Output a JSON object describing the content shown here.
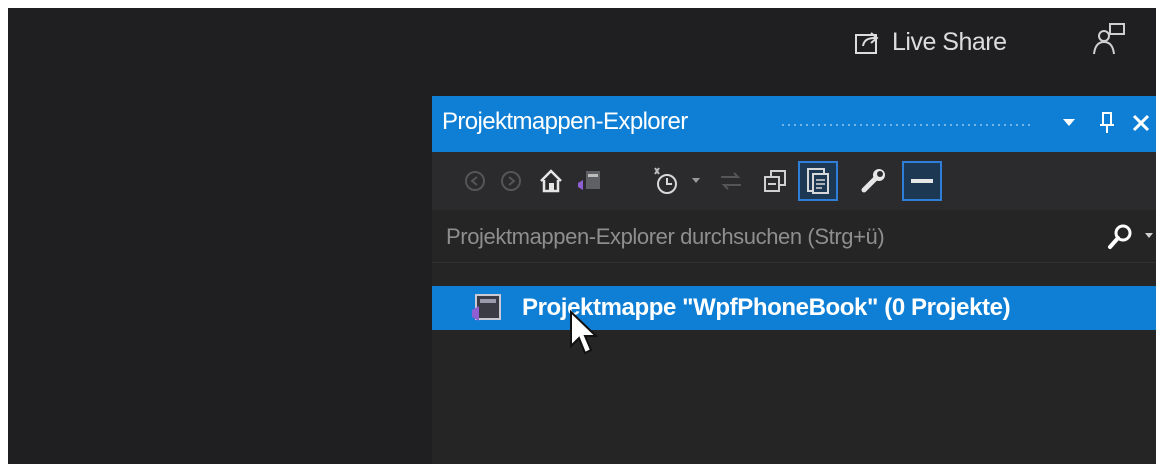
{
  "topbar": {
    "live_share_label": "Live Share",
    "live_share_icon": "live-share-icon",
    "feedback_icon": "feedback-person-icon"
  },
  "solution_explorer": {
    "title": "Projektmappen-Explorer",
    "title_buttons": [
      "dropdown-icon",
      "pin-icon",
      "close-icon"
    ],
    "toolbar_icons": [
      "back-icon",
      "forward-icon",
      "home-icon",
      "switch-views-icon",
      "pending-changes-icon",
      "dropdown-icon",
      "sync-icon",
      "collapse-all-icon",
      "show-all-files-icon",
      "properties-icon",
      "preview-icon"
    ],
    "search": {
      "placeholder": "Projektmappen-Explorer durchsuchen (Strg+ü)"
    },
    "tree": [
      {
        "label": "Projektmappe \"WpfPhoneBook\" (0 Projekte)",
        "icon": "solution-icon",
        "selected": true
      }
    ]
  },
  "colors": {
    "accent": "#0e7fd4",
    "background": "#1f1f22",
    "panel": "#252526",
    "toolbar": "#2b2b2d"
  }
}
